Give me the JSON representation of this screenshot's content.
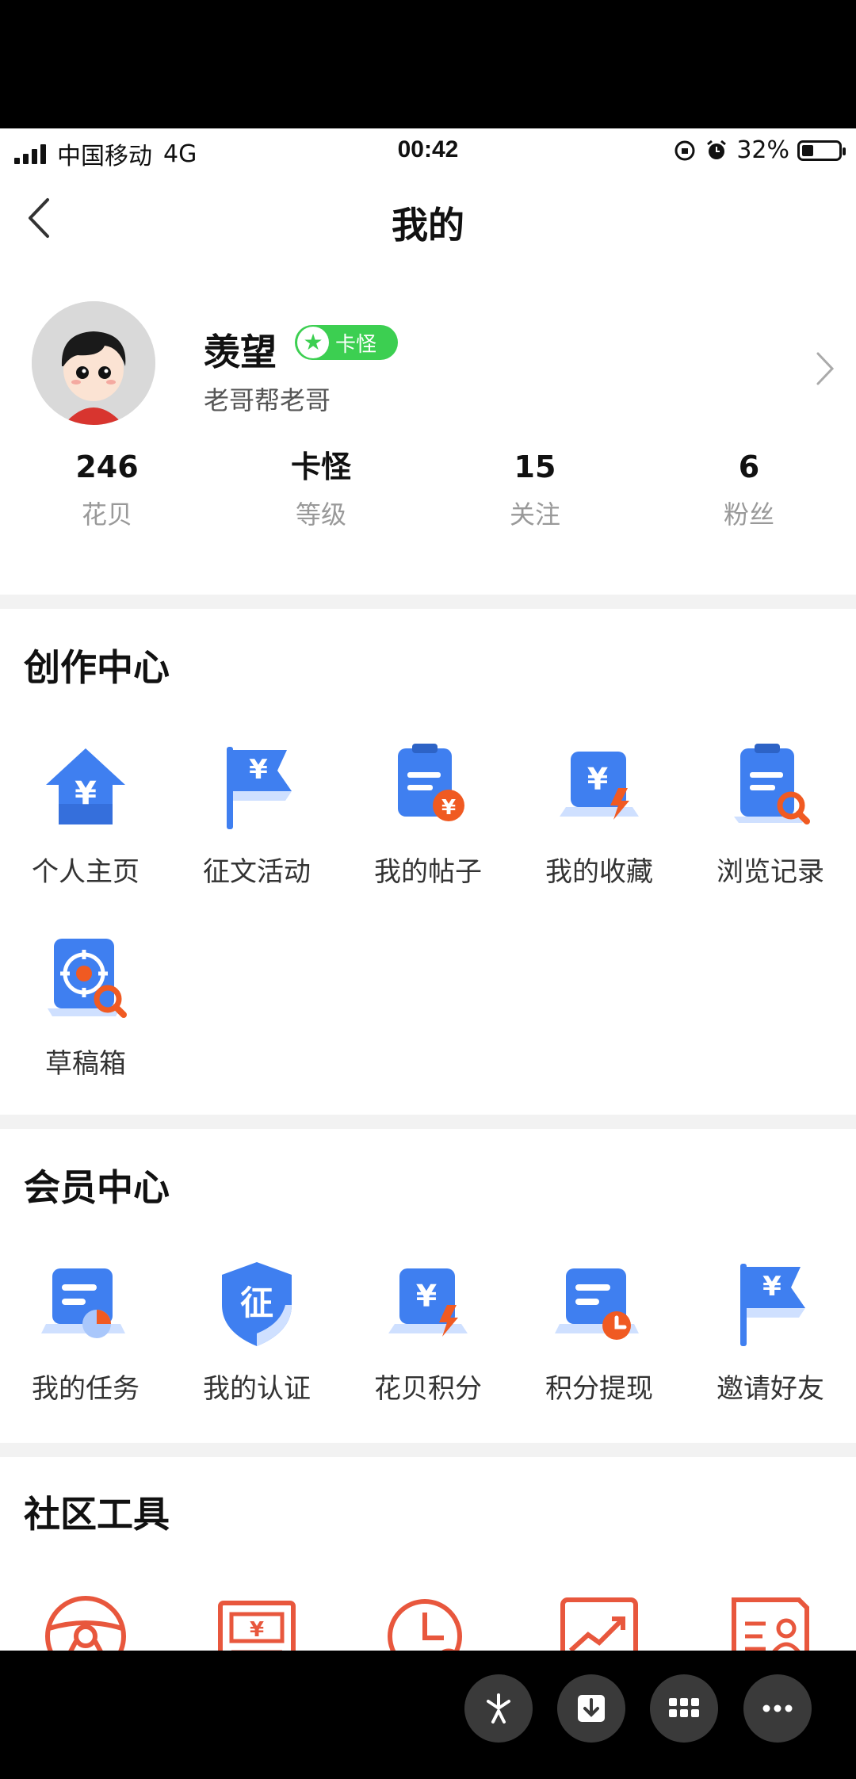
{
  "status_bar": {
    "carrier": "中国移动",
    "network": "4G",
    "time": "00:42",
    "battery": "32%"
  },
  "nav": {
    "title": "我的"
  },
  "profile": {
    "name": "羡望",
    "badge": "卡怪",
    "subtitle": "老哥帮老哥"
  },
  "stats": [
    {
      "value": "246",
      "label": "花贝"
    },
    {
      "value": "卡怪",
      "label": "等级"
    },
    {
      "value": "15",
      "label": "关注"
    },
    {
      "value": "6",
      "label": "粉丝"
    }
  ],
  "creation_center": {
    "title": "创作中心",
    "items": [
      {
        "label": "个人主页",
        "icon": "home-yuan-icon"
      },
      {
        "label": "征文活动",
        "icon": "flag-yuan-icon"
      },
      {
        "label": "我的帖子",
        "icon": "post-icon"
      },
      {
        "label": "我的收藏",
        "icon": "favorites-icon"
      },
      {
        "label": "浏览记录",
        "icon": "history-icon"
      },
      {
        "label": "草稿箱",
        "icon": "drafts-icon"
      }
    ]
  },
  "member_center": {
    "title": "会员中心",
    "items": [
      {
        "label": "我的任务",
        "icon": "tasks-icon"
      },
      {
        "label": "我的认证",
        "icon": "certification-shield-icon"
      },
      {
        "label": "花贝积分",
        "icon": "points-icon"
      },
      {
        "label": "积分提现",
        "icon": "withdraw-icon"
      },
      {
        "label": "邀请好友",
        "icon": "invite-flag-icon"
      }
    ]
  },
  "community_tools": {
    "title": "社区工具",
    "items": [
      {
        "icon": "steering-wheel-icon"
      },
      {
        "icon": "banknote-icon"
      },
      {
        "icon": "clock-icon"
      },
      {
        "icon": "trend-chart-icon"
      },
      {
        "icon": "resume-card-icon"
      }
    ]
  },
  "colors": {
    "primary_blue": "#3f7ff0",
    "accent_orange": "#f05a22",
    "badge_green": "#3ccf51",
    "tool_red": "#e8573d"
  }
}
